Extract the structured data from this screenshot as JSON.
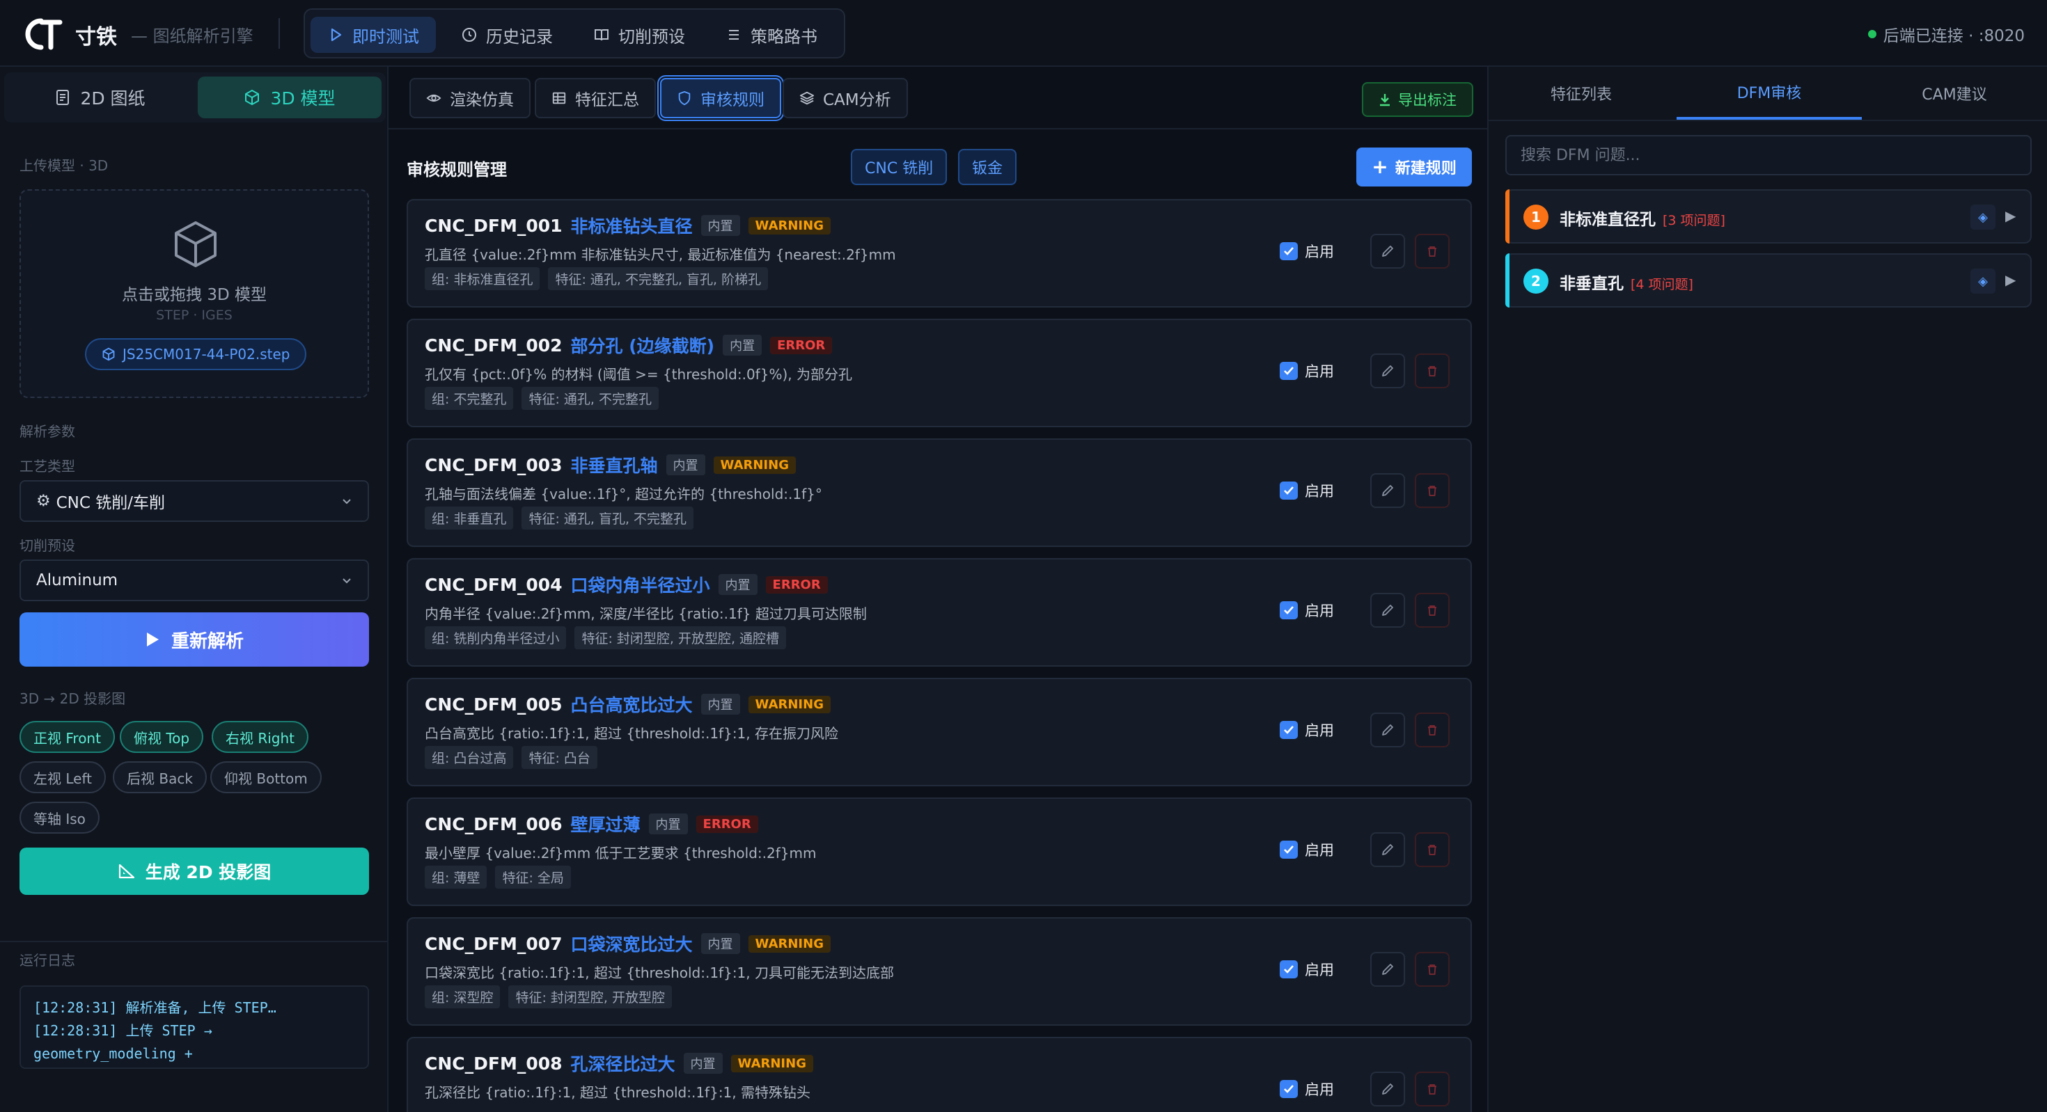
{
  "app": {
    "brand": "寸铁",
    "subtitle": "— 图纸解析引擎",
    "status": "后端已连接 · :8020",
    "status_color": "#22c55e"
  },
  "nav": {
    "tabs": [
      {
        "label": "即时测试",
        "icon": "play-icon",
        "active": true
      },
      {
        "label": "历史记录",
        "icon": "clock-icon",
        "active": false
      },
      {
        "label": "切削预设",
        "icon": "book-icon",
        "active": false
      },
      {
        "label": "策略路书",
        "icon": "list-icon",
        "active": false
      }
    ]
  },
  "left": {
    "tabs": [
      {
        "label": "2D 图纸",
        "icon": "document-icon",
        "active": false
      },
      {
        "label": "3D 模型",
        "icon": "cube-icon",
        "active": true
      }
    ],
    "upload_label": "上传模型 · 3D",
    "dropzone_text": "点击或拖拽 3D 模型",
    "dropzone_formats": "STEP · IGES",
    "file_name": "JS25CM017-44-P02.step",
    "params_label": "解析参数",
    "process_label": "工艺类型",
    "process_value": "CNC 铣削/车削",
    "preset_label": "切削预设",
    "preset_value": "Aluminum",
    "reparse_button": "重新解析",
    "projection_label": "3D → 2D 投影图",
    "views": [
      {
        "label": "正视 Front",
        "on": true
      },
      {
        "label": "俯视 Top",
        "on": true
      },
      {
        "label": "右视 Right",
        "on": true
      },
      {
        "label": "左视 Left",
        "on": false
      },
      {
        "label": "后视 Back",
        "on": false
      },
      {
        "label": "仰视 Bottom",
        "on": false
      },
      {
        "label": "等轴 Iso",
        "on": false
      }
    ],
    "generate_button": "生成 2D 投影图",
    "log_label": "运行日志",
    "log_lines": [
      "[12:28:31] 解析准备, 上传 STEP…",
      "[12:28:31] 上传 STEP →",
      "geometry_modeling +"
    ]
  },
  "center": {
    "tabs": [
      {
        "label": "渲染仿真",
        "icon": "eye-icon",
        "active": false
      },
      {
        "label": "特征汇总",
        "icon": "table-icon",
        "active": false
      },
      {
        "label": "审核规则",
        "icon": "shield-icon",
        "active": true
      },
      {
        "label": "CAM分析",
        "icon": "layers-icon",
        "active": false
      }
    ],
    "export_button": "导出标注",
    "rules_title": "审核规则管理",
    "filters": [
      "CNC 铣削",
      "钣金"
    ],
    "new_rule_button": "新建规则",
    "builtin_label": "内置",
    "enable_label": "启用",
    "rules": [
      {
        "id": "CNC_DFM_001",
        "name": "非标准钻头直径",
        "severity": "WARNING",
        "desc": "孔直径 {value:.2f}mm 非标准钻头尺寸, 最近标准值为 {nearest:.2f}mm",
        "group": "组: 非标准直径孔",
        "features": "特征: 通孔, 不完整孔, 盲孔, 阶梯孔"
      },
      {
        "id": "CNC_DFM_002",
        "name": "部分孔 (边缘截断)",
        "severity": "ERROR",
        "desc": "孔仅有 {pct:.0f}% 的材料 (阈值 >= {threshold:.0f}%), 为部分孔",
        "group": "组: 不完整孔",
        "features": "特征: 通孔, 不完整孔"
      },
      {
        "id": "CNC_DFM_003",
        "name": "非垂直孔轴",
        "severity": "WARNING",
        "desc": "孔轴与面法线偏差 {value:.1f}°, 超过允许的 {threshold:.1f}°",
        "group": "组: 非垂直孔",
        "features": "特征: 通孔, 盲孔, 不完整孔"
      },
      {
        "id": "CNC_DFM_004",
        "name": "口袋内角半径过小",
        "severity": "ERROR",
        "desc": "内角半径 {value:.2f}mm, 深度/半径比 {ratio:.1f} 超过刀具可达限制",
        "group": "组: 铣削内角半径过小",
        "features": "特征: 封闭型腔, 开放型腔, 通腔槽"
      },
      {
        "id": "CNC_DFM_005",
        "name": "凸台高宽比过大",
        "severity": "WARNING",
        "desc": "凸台高宽比 {ratio:.1f}:1, 超过 {threshold:.1f}:1, 存在振刀风险",
        "group": "组: 凸台过高",
        "features": "特征: 凸台"
      },
      {
        "id": "CNC_DFM_006",
        "name": "壁厚过薄",
        "severity": "ERROR",
        "desc": "最小壁厚 {value:.2f}mm 低于工艺要求 {threshold:.2f}mm",
        "group": "组: 薄壁",
        "features": "特征: 全局"
      },
      {
        "id": "CNC_DFM_007",
        "name": "口袋深宽比过大",
        "severity": "WARNING",
        "desc": "口袋深宽比 {ratio:.1f}:1, 超过 {threshold:.1f}:1, 刀具可能无法到达底部",
        "group": "组: 深型腔",
        "features": "特征: 封闭型腔, 开放型腔"
      },
      {
        "id": "CNC_DFM_008",
        "name": "孔深径比过大",
        "severity": "WARNING",
        "desc": "孔深径比 {ratio:.1f}:1, 超过 {threshold:.1f}:1, 需特殊钻头",
        "group": "",
        "features": ""
      }
    ]
  },
  "right": {
    "tabs": [
      {
        "label": "特征列表",
        "active": false
      },
      {
        "label": "DFM审核",
        "active": true
      },
      {
        "label": "CAM建议",
        "active": false
      }
    ],
    "search_placeholder": "搜索 DFM 问题...",
    "issues": [
      {
        "num": "1",
        "title": "非标准直径孔",
        "count": "[3 项问题]",
        "color": "#f97316"
      },
      {
        "num": "2",
        "title": "非垂直孔",
        "count": "[4 项问题]",
        "color": "#22d3ee"
      }
    ]
  }
}
